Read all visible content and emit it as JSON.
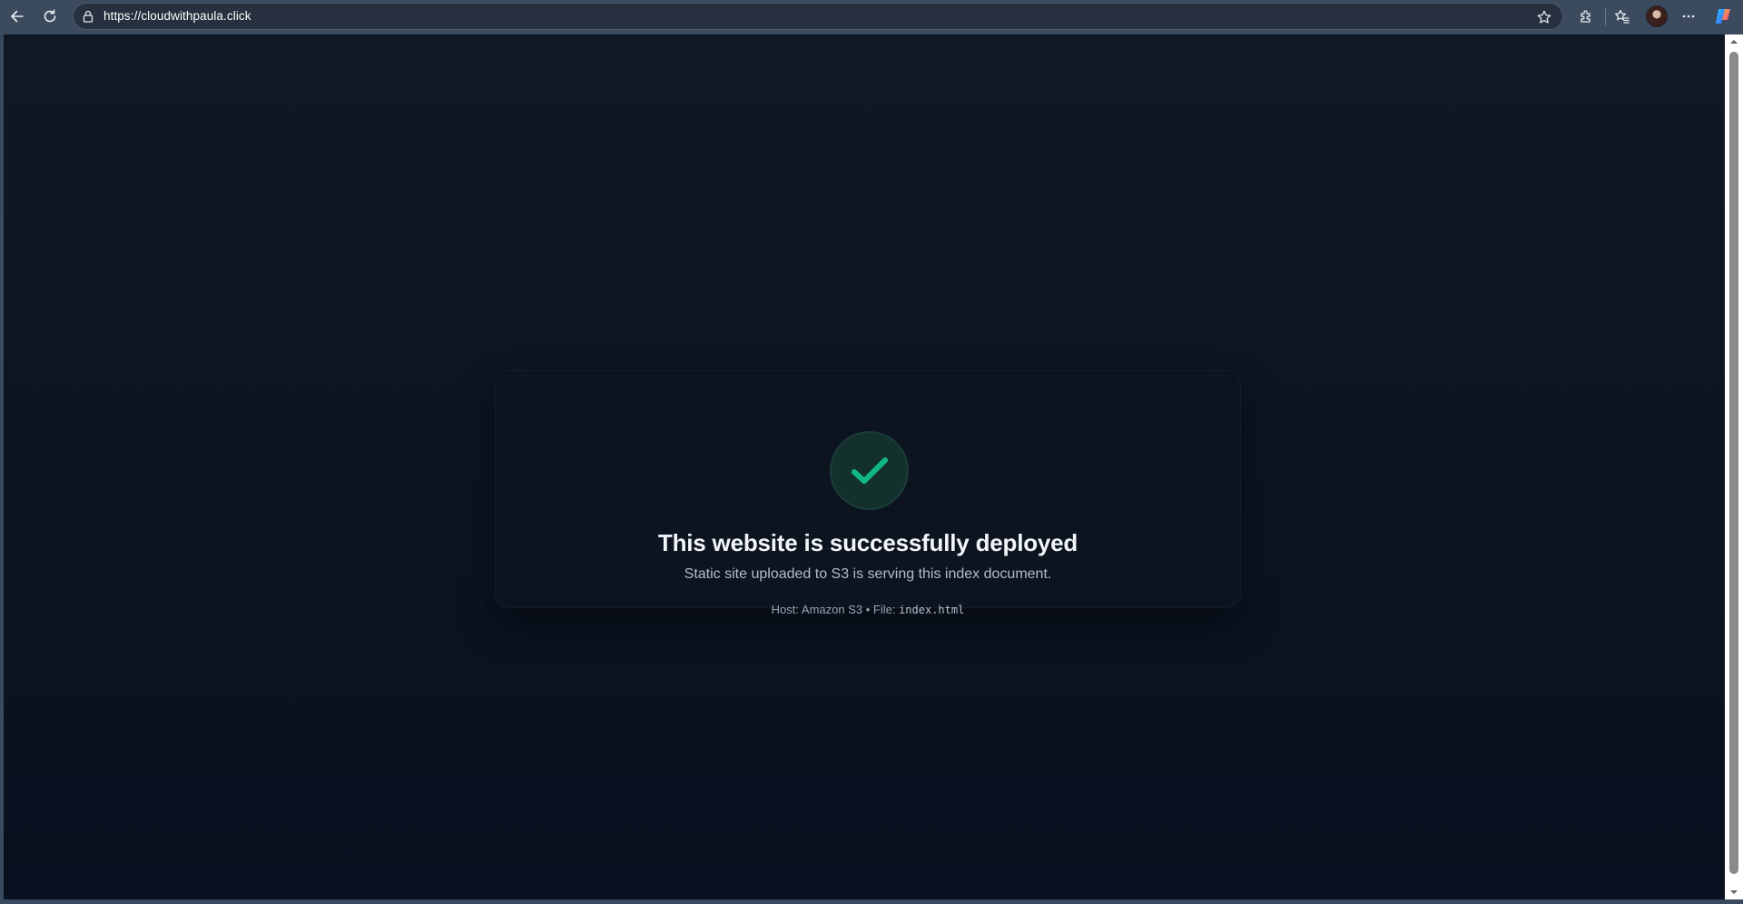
{
  "browser": {
    "url": "https://cloudwithpaula.click",
    "icons": {
      "back": "back-arrow-icon",
      "refresh": "refresh-icon",
      "lock": "lock-icon",
      "favorite": "star-icon",
      "extensions": "puzzle-icon",
      "favorites_bar": "favorites-icon",
      "more": "more-icon",
      "copilot": "copilot-icon"
    }
  },
  "page": {
    "title": "This website is successfully deployed",
    "subtitle": "Static site uploaded to S3 is serving this index document.",
    "meta_host": "Host: Amazon S3 • File: ",
    "meta_file": "index.html",
    "status_icon": "checkmark-icon",
    "colors": {
      "background": "#0d1522",
      "card": "#0c1420",
      "accent": "#10b981"
    }
  }
}
